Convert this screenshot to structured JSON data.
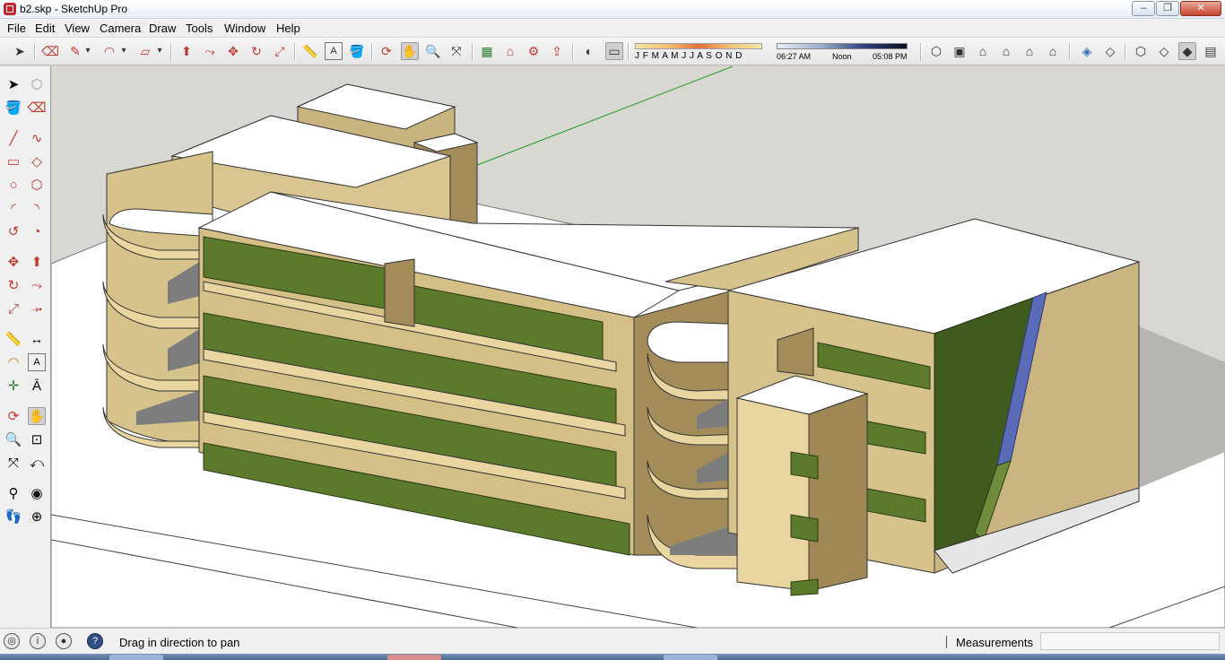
{
  "window": {
    "title": "b2.skp - SketchUp Pro",
    "controls": {
      "minimize": "–",
      "maximize": "❐",
      "close": "✕"
    }
  },
  "menu": [
    "File",
    "Edit",
    "View",
    "Camera",
    "Draw",
    "Tools",
    "Window",
    "Help"
  ],
  "toolbar": {
    "tools": [
      {
        "name": "select-tool",
        "glyph": "➤"
      },
      {
        "name": "eraser-tool",
        "glyph": "⌫"
      },
      {
        "name": "pencil-tool",
        "glyph": "✎"
      },
      {
        "name": "pencil-dropdown-arrow",
        "glyph": "▾"
      },
      {
        "name": "arc-tool",
        "glyph": "◠"
      },
      {
        "name": "arc-dropdown-arrow",
        "glyph": "▾"
      },
      {
        "name": "rectangle-tool",
        "glyph": "▱"
      },
      {
        "name": "rectangle-dropdown-arrow",
        "glyph": "▾"
      },
      {
        "name": "push-pull-tool",
        "glyph": "⬆"
      },
      {
        "name": "follow-me-tool",
        "glyph": "⤳"
      },
      {
        "name": "move-tool",
        "glyph": "✥"
      },
      {
        "name": "rotate-tool",
        "glyph": "↻"
      },
      {
        "name": "scale-tool",
        "glyph": "⤢"
      },
      {
        "name": "tape-measure-tool",
        "glyph": "📏"
      },
      {
        "name": "text-tool",
        "glyph": "A"
      },
      {
        "name": "paint-bucket-tool",
        "glyph": "🪣"
      },
      {
        "name": "orbit-tool",
        "glyph": "⟳"
      },
      {
        "name": "pan-tool",
        "glyph": "✋"
      },
      {
        "name": "zoom-tool",
        "glyph": "🔍"
      },
      {
        "name": "zoom-extents-tool",
        "glyph": "⤧"
      },
      {
        "name": "components-tool",
        "glyph": "▦"
      },
      {
        "name": "warehouse-tool",
        "glyph": "⌂"
      },
      {
        "name": "extension-tool",
        "glyph": "⚙"
      },
      {
        "name": "share-model-tool",
        "glyph": "⇪"
      },
      {
        "name": "shadows-toggle",
        "glyph": "◐"
      },
      {
        "name": "shadow-settings-toggle",
        "glyph": "▭"
      }
    ],
    "months_label": "J F M A M J J A S O N D",
    "time_start": "06:27 AM",
    "time_noon": "Noon",
    "time_end": "05:08 PM",
    "views": [
      {
        "name": "iso-view-icon",
        "glyph": "⬡"
      },
      {
        "name": "top-view-icon",
        "glyph": "▣"
      },
      {
        "name": "front-view-icon",
        "glyph": "⌂"
      },
      {
        "name": "right-view-icon",
        "glyph": "⌂"
      },
      {
        "name": "back-view-icon",
        "glyph": "⌂"
      },
      {
        "name": "left-view-icon",
        "glyph": "⌂"
      },
      {
        "name": "xray-style-icon",
        "glyph": "◈"
      },
      {
        "name": "back-edges-style-icon",
        "glyph": "◇"
      },
      {
        "name": "wireframe-style-icon",
        "glyph": "⬡"
      },
      {
        "name": "hidden-line-style-icon",
        "glyph": "◇"
      },
      {
        "name": "shaded-style-icon",
        "glyph": "◆"
      },
      {
        "name": "shaded-textures-style-icon",
        "glyph": "▤"
      }
    ]
  },
  "left_toolbar": [
    {
      "name": "select-icon",
      "glyph": "➤"
    },
    {
      "name": "make-component-icon",
      "glyph": "⬡"
    },
    {
      "name": "paint-bucket-icon",
      "glyph": "🪣"
    },
    {
      "name": "eraser-icon",
      "glyph": "⌫"
    },
    {
      "name": "line-icon",
      "glyph": "╱"
    },
    {
      "name": "freehand-icon",
      "glyph": "∿"
    },
    {
      "name": "rectangle-icon",
      "glyph": "▭"
    },
    {
      "name": "rotated-rectangle-icon",
      "glyph": "◇"
    },
    {
      "name": "circle-icon",
      "glyph": "○"
    },
    {
      "name": "polygon-icon",
      "glyph": "⬡"
    },
    {
      "name": "arc-icon",
      "glyph": "◜"
    },
    {
      "name": "two-point-arc-icon",
      "glyph": "◝"
    },
    {
      "name": "three-point-arc-icon",
      "glyph": "↺"
    },
    {
      "name": "pie-icon",
      "glyph": "◔"
    },
    {
      "name": "move-icon",
      "glyph": "✥"
    },
    {
      "name": "push-pull-icon",
      "glyph": "⬆"
    },
    {
      "name": "rotate-icon",
      "glyph": "↻"
    },
    {
      "name": "follow-me-icon",
      "glyph": "⤳"
    },
    {
      "name": "scale-icon",
      "glyph": "⤢"
    },
    {
      "name": "offset-icon",
      "glyph": "⤞"
    },
    {
      "name": "tape-measure-icon",
      "glyph": "📏"
    },
    {
      "name": "dimension-icon",
      "glyph": "↔"
    },
    {
      "name": "protractor-icon",
      "glyph": "◠"
    },
    {
      "name": "text-icon",
      "glyph": "A"
    },
    {
      "name": "axes-icon",
      "glyph": "✛"
    },
    {
      "name": "3d-text-icon",
      "glyph": "Ā"
    },
    {
      "name": "orbit-icon",
      "glyph": "⟳"
    },
    {
      "name": "pan-icon",
      "glyph": "✋"
    },
    {
      "name": "zoom-icon",
      "glyph": "🔍"
    },
    {
      "name": "zoom-window-icon",
      "glyph": "⊡"
    },
    {
      "name": "zoom-extents-icon",
      "glyph": "⤧"
    },
    {
      "name": "previous-view-icon",
      "glyph": "⤺"
    },
    {
      "name": "position-camera-icon",
      "glyph": "⚲"
    },
    {
      "name": "look-around-icon",
      "glyph": "◉"
    },
    {
      "name": "walk-icon",
      "glyph": "👣"
    },
    {
      "name": "section-plane-icon",
      "glyph": "⊕"
    }
  ],
  "status": {
    "hint": "Drag in direction to pan",
    "measurements_label": "Measurements",
    "measurements_value": ""
  },
  "colors": {
    "viewport_bg": "#d8d7d2",
    "ground": "#ffffff",
    "wall_light": "#e8d5a0",
    "wall_mid": "#c9b482",
    "wall_dark": "#8e7a4f",
    "glass_green": "#5b7a2c",
    "accent_blue": "#5a6bb8"
  }
}
